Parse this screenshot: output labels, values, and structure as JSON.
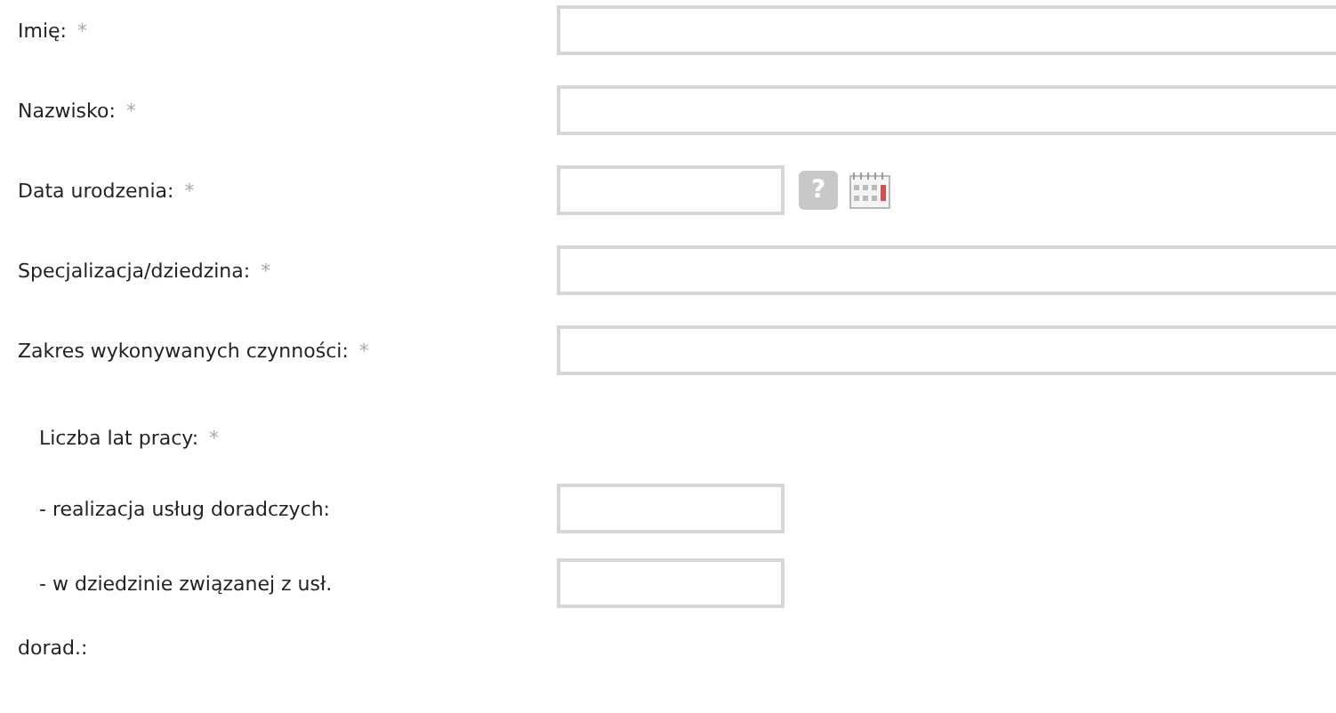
{
  "fields": [
    {
      "kind": "text",
      "label": "Imię:",
      "required_mark": "*"
    },
    {
      "kind": "text",
      "label": "Nazwisko:",
      "required_mark": "*"
    },
    {
      "kind": "date",
      "label": "Data urodzenia:",
      "required_mark": "*",
      "help": "?"
    },
    {
      "kind": "text",
      "label": "Specjalizacja/dziedzina:",
      "required_mark": "*"
    },
    {
      "kind": "text",
      "label": "Zakres wykonywanych czynności:",
      "required_mark": "*"
    }
  ],
  "experience": {
    "label": "Liczba lat pracy:",
    "required_mark": "*",
    "fields": [
      {
        "label_lines": [
          "- realizacja usług doradczych:"
        ]
      },
      {
        "label_lines": [
          "- w dziedzinie związanej z usł.",
          "dorad.:"
        ]
      }
    ]
  }
}
